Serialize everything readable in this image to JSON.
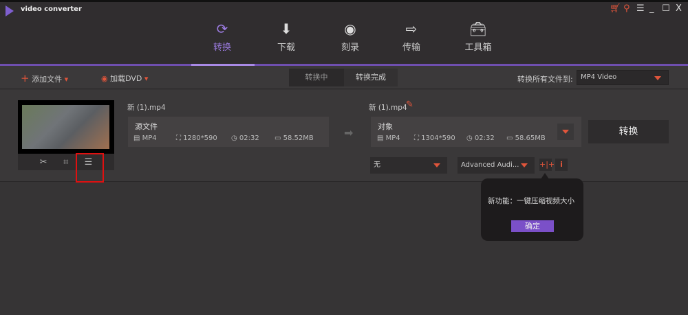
{
  "app": {
    "title": "video converter",
    "window_controls": [
      "cart-icon",
      "key-icon",
      "menu-icon",
      "minimize-icon",
      "maximize-icon",
      "close-icon"
    ]
  },
  "nav": [
    {
      "label": "转换",
      "icon": "convert-icon",
      "active": true
    },
    {
      "label": "下载",
      "icon": "download-icon"
    },
    {
      "label": "刻录",
      "icon": "burn-icon"
    },
    {
      "label": "传输",
      "icon": "transfer-icon"
    },
    {
      "label": "工具箱",
      "icon": "toolbox-icon"
    }
  ],
  "toolbar": {
    "add_file": "添加文件",
    "load_dvd": "加载DVD",
    "tabs": [
      "转换中",
      "转换完成"
    ],
    "convert_all_label": "转换所有文件到:",
    "format": "MP4 Video"
  },
  "item": {
    "source": {
      "name": "新 (1).mp4",
      "title": "源文件",
      "format": "MP4",
      "resolution": "1280*590",
      "duration": "02:32",
      "size": "58.52MB"
    },
    "target": {
      "name": "新 (1).mp4",
      "title": "对象",
      "format": "MP4",
      "resolution": "1304*590",
      "duration": "02:32",
      "size": "58.65MB"
    },
    "convert_button": "转换",
    "subtitle": "无",
    "audio": "Advanced Audi..."
  },
  "popup": {
    "message": "新功能：一键压缩视频大小",
    "ok": "确定"
  },
  "colors": {
    "accent": "#7b50c8",
    "red": "#e0553b"
  }
}
